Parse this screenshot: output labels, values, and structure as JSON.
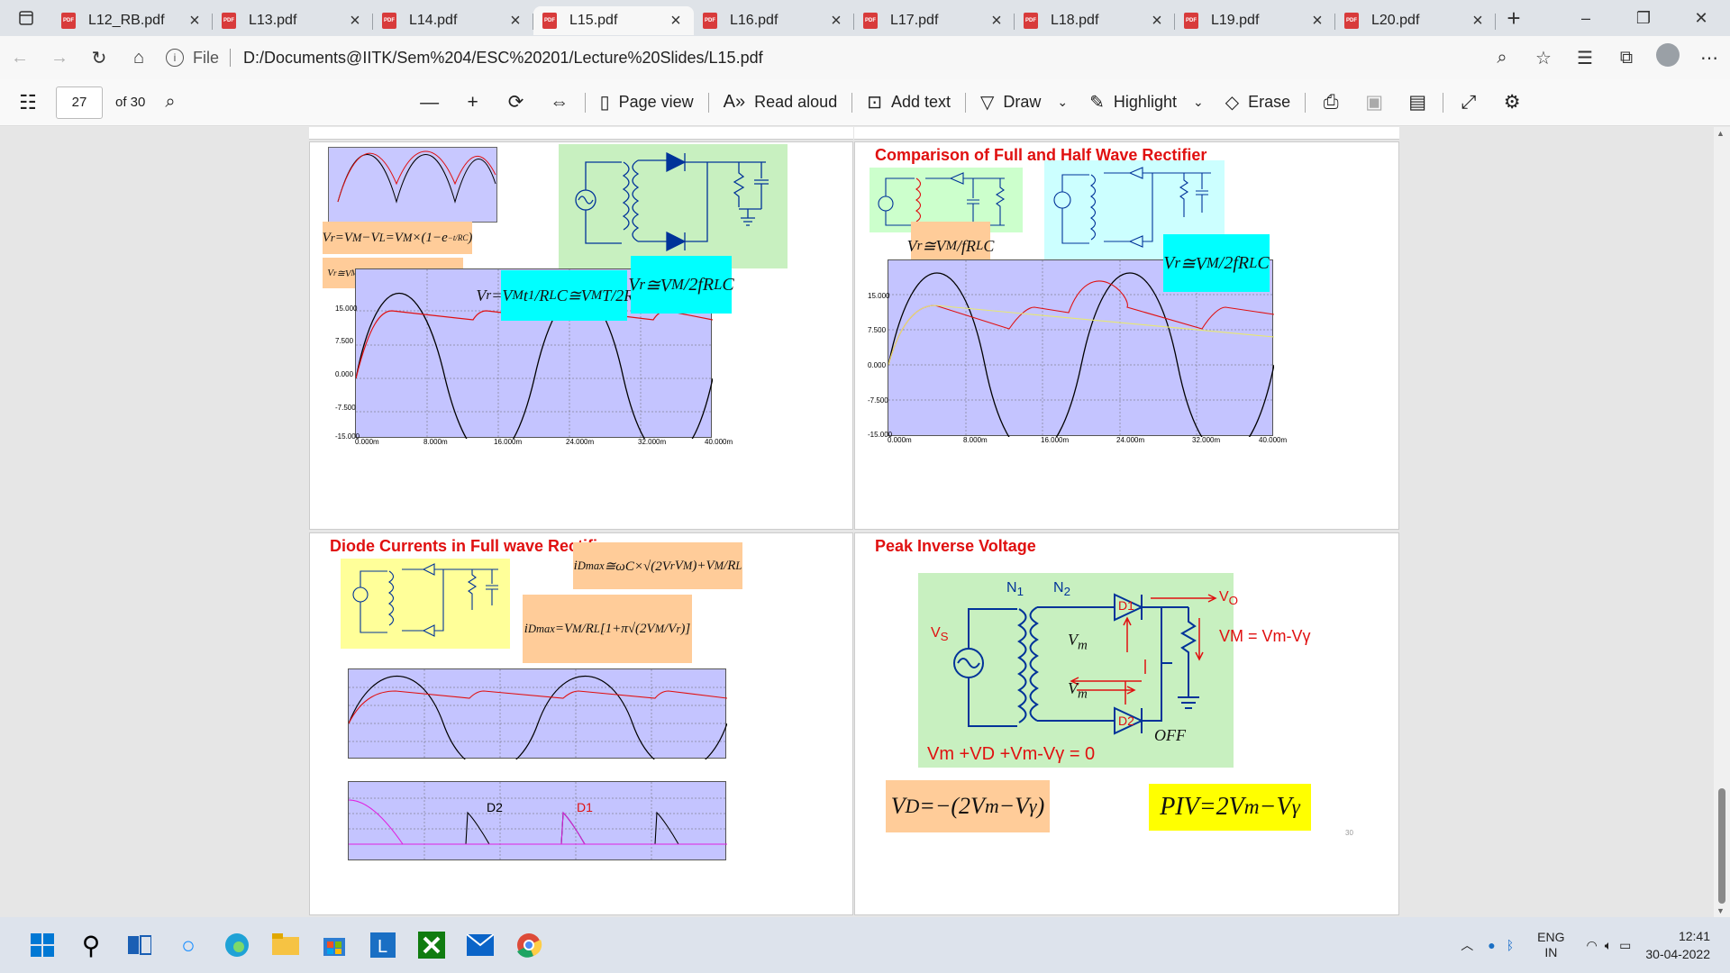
{
  "tabs": [
    {
      "label": "L12_RB.pdf",
      "active": false
    },
    {
      "label": "L13.pdf",
      "active": false
    },
    {
      "label": "L14.pdf",
      "active": false
    },
    {
      "label": "L15.pdf",
      "active": true
    },
    {
      "label": "L16.pdf",
      "active": false
    },
    {
      "label": "L17.pdf",
      "active": false
    },
    {
      "label": "L18.pdf",
      "active": false
    },
    {
      "label": "L19.pdf",
      "active": false
    },
    {
      "label": "L20.pdf",
      "active": false
    }
  ],
  "address": {
    "file_label": "File",
    "url": "D:/Documents@IITK/Sem%204/ESC%20201/Lecture%20Slides/L15.pdf"
  },
  "pdf_toolbar": {
    "page_number": "27",
    "page_count": "of 30",
    "page_view": "Page view",
    "read_aloud": "Read aloud",
    "add_text": "Add text",
    "draw": "Draw",
    "highlight": "Highlight",
    "erase": "Erase"
  },
  "slides": {
    "s2_title": "Comparison of Full and Half Wave Rectifier",
    "s3_title": "Diode Currents in Full wave Rectifier",
    "s4_title": "Peak Inverse Voltage",
    "s4_eq_sum": "Vm  +VD  +Vm-Vγ = 0",
    "s4_vm_label": "VM = Vm-Vγ",
    "s4_off": "OFF",
    "s4_page": "30",
    "s3_d1": "D1",
    "s3_d2": "D2",
    "plot_y_ticks": [
      "15.000",
      "7.500",
      "0.000",
      "-7.500",
      "-15.000"
    ],
    "plot_x_ticks": [
      "0.000m",
      "8.000m",
      "16.000m",
      "24.000m",
      "32.000m",
      "40.000m"
    ]
  },
  "taskbar": {
    "lang1": "ENG",
    "lang2": "IN",
    "time": "12:41",
    "date": "30-04-2022"
  }
}
